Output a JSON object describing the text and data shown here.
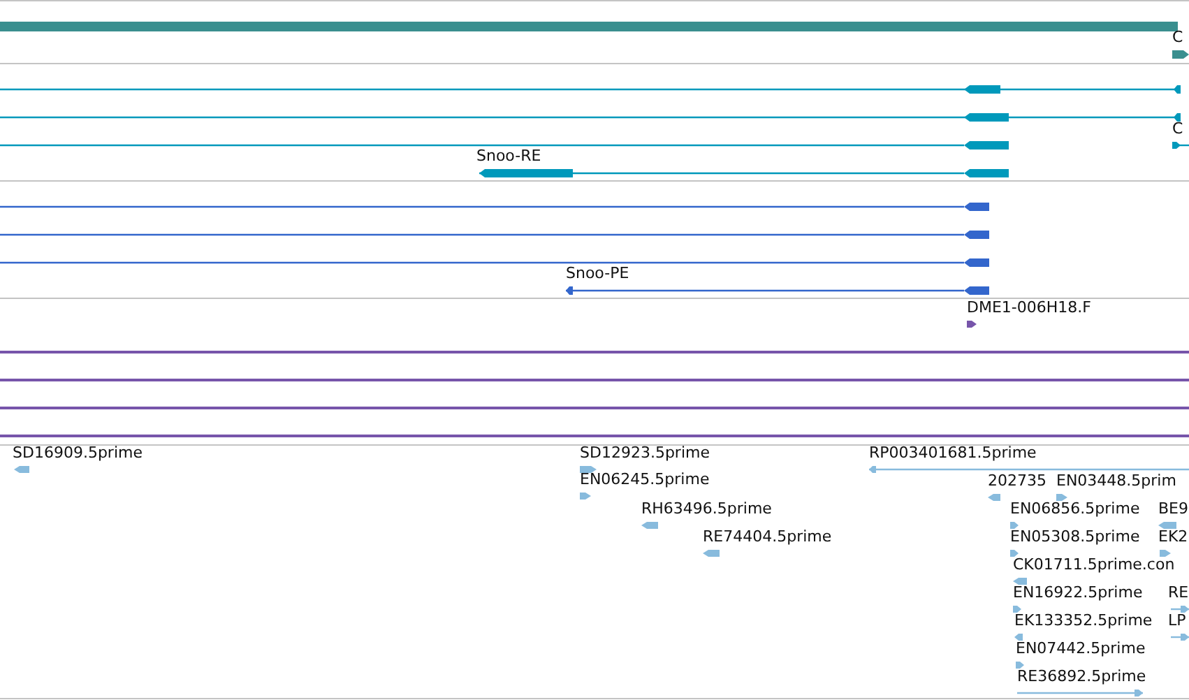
{
  "tracks": [
    {
      "color": "#3a8f8f",
      "features": [
        {
          "kind": "bar"
        },
        {
          "kind": "transcript",
          "label": "C",
          "forward": true
        }
      ]
    },
    {
      "color": "#0099bb",
      "features": [
        {
          "kind": "transcript",
          "forward": false
        },
        {
          "kind": "transcript",
          "forward": false
        },
        {
          "kind": "transcript",
          "label": "C",
          "forward": true
        },
        {
          "kind": "transcript",
          "forward": false
        },
        {
          "kind": "transcript",
          "label": "Snoo-RE",
          "forward": false
        }
      ]
    },
    {
      "color": "#3366cc",
      "features": [
        {
          "kind": "transcript",
          "forward": false
        },
        {
          "kind": "transcript",
          "forward": false
        },
        {
          "kind": "transcript",
          "forward": false
        },
        {
          "kind": "transcript",
          "label": "Snoo-PE",
          "forward": false
        }
      ]
    },
    {
      "color": "#7755aa",
      "features": [
        {
          "kind": "transcript",
          "label": "DME1-006H18.F",
          "forward": true
        },
        {
          "kind": "bar"
        },
        {
          "kind": "bar"
        },
        {
          "kind": "bar"
        },
        {
          "kind": "bar"
        }
      ]
    },
    {
      "color": "#88bbdd",
      "features": [
        {
          "kind": "transcript",
          "label": "SD16909.5prime",
          "forward": false
        },
        {
          "kind": "transcript",
          "label": "SD12923.5prime",
          "forward": true
        },
        {
          "kind": "transcript",
          "label": "EN06245.5prime",
          "forward": true
        },
        {
          "kind": "transcript",
          "label": "RH63496.5prime",
          "forward": false
        },
        {
          "kind": "transcript",
          "label": "RE74404.5prime",
          "forward": false
        },
        {
          "kind": "transcript",
          "label": "RP003401681.5prime",
          "forward": false
        },
        {
          "kind": "transcript",
          "label": "202735",
          "forward": false
        },
        {
          "kind": "transcript",
          "label": "EN03448.5prim",
          "forward": true
        },
        {
          "kind": "transcript",
          "label": "EN06856.5prime",
          "forward": true
        },
        {
          "kind": "transcript",
          "label": "BE9",
          "forward": false
        },
        {
          "kind": "transcript",
          "label": "EN05308.5prime",
          "forward": true
        },
        {
          "kind": "transcript",
          "label": "EK2",
          "forward": true
        },
        {
          "kind": "transcript",
          "label": "CK01711.5prime.con",
          "forward": false
        },
        {
          "kind": "transcript",
          "label": "EN16922.5prime",
          "forward": true
        },
        {
          "kind": "transcript",
          "label": "RE",
          "forward": true
        },
        {
          "kind": "transcript",
          "label": "EK133352.5prime",
          "forward": false
        },
        {
          "kind": "transcript",
          "label": "LP",
          "forward": true
        },
        {
          "kind": "transcript",
          "label": "EN07442.5prime",
          "forward": true
        },
        {
          "kind": "transcript",
          "label": "RE36892.5prime",
          "forward": true
        }
      ]
    }
  ]
}
